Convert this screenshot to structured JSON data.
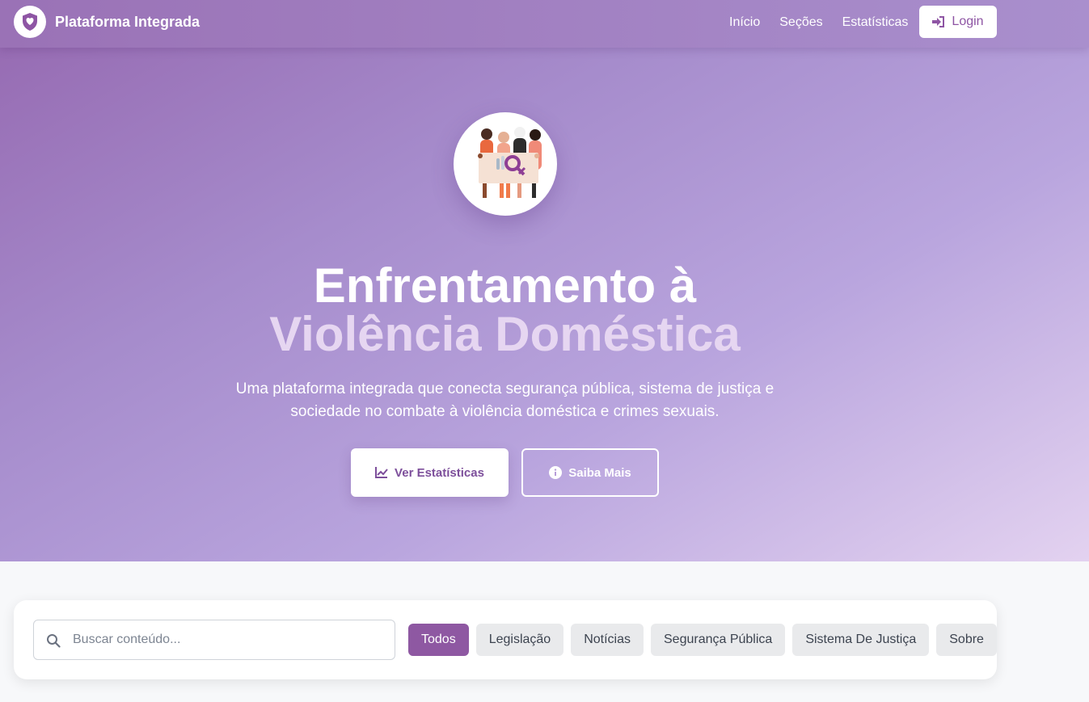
{
  "navbar": {
    "brand": "Plataforma Integrada",
    "links": [
      "Início",
      "Seções",
      "Estatísticas"
    ],
    "login_label": "Login"
  },
  "hero": {
    "title_line1": "Enfrentamento à",
    "title_line2": "Violência Doméstica",
    "subtitle": "Uma plataforma integrada que conecta segurança pública, sistema de justiça e sociedade no combate à violência doméstica e crimes sexuais.",
    "primary_button": "Ver Estatísticas",
    "secondary_button": "Saiba Mais"
  },
  "filters": {
    "search_placeholder": "Buscar conteúdo...",
    "categories": [
      "Todos",
      "Legislação",
      "Notícias",
      "Segurança Pública",
      "Sistema De Justiça",
      "Sobre"
    ],
    "active_category": "Todos"
  },
  "colors": {
    "brand_purple": "#8e58a2",
    "hero_start": "#9568b0",
    "hero_end": "#e3d2f0",
    "accent_text": "#e6d6f1"
  },
  "icons": {
    "brand": "shield-heart-icon",
    "login": "sign-in-icon",
    "hero_illustration": "women-group-illustration",
    "stats": "line-chart-icon",
    "info": "info-circle-icon",
    "search": "search-icon"
  }
}
